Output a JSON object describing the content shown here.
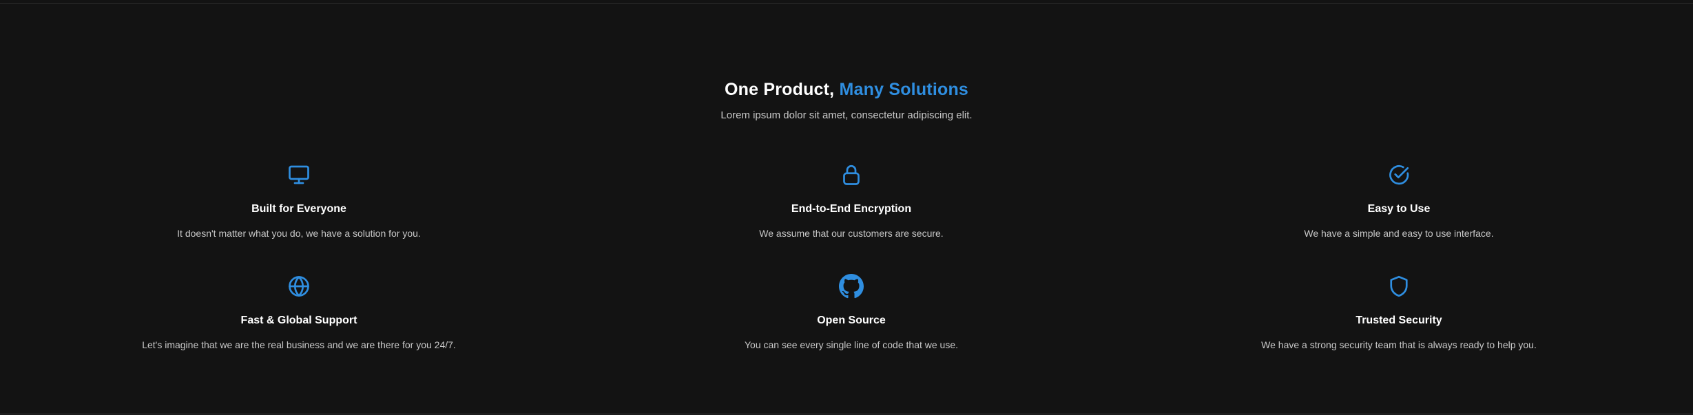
{
  "heading": {
    "prefix": "One Product,",
    "accent": "Many Solutions"
  },
  "subtitle": "Lorem ipsum dolor sit amet, consectetur adipiscing elit.",
  "colors": {
    "background": "#131313",
    "accent": "#2f8ee0",
    "title": "#ffffff",
    "text": "#c9c9c9"
  },
  "features": [
    {
      "icon": "monitor-icon",
      "title": "Built for Everyone",
      "description": "It doesn't matter what you do, we have a solution for you."
    },
    {
      "icon": "lock-icon",
      "title": "End-to-End Encryption",
      "description": "We assume that our customers are secure."
    },
    {
      "icon": "check-circle-icon",
      "title": "Easy to Use",
      "description": "We have a simple and easy to use interface."
    },
    {
      "icon": "globe-icon",
      "title": "Fast & Global Support",
      "description": "Let's imagine that we are the real business and we are there for you 24/7."
    },
    {
      "icon": "github-icon",
      "title": "Open Source",
      "description": "You can see every single line of code that we use."
    },
    {
      "icon": "shield-icon",
      "title": "Trusted Security",
      "description": "We have a strong security team that is always ready to help you."
    }
  ]
}
